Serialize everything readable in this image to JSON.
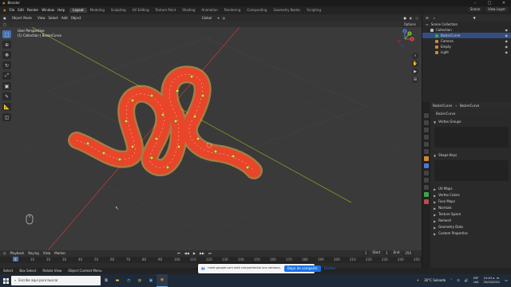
{
  "app": {
    "title": "Blender",
    "window_controls": [
      "–",
      "□",
      "✕"
    ]
  },
  "menubar": {
    "menus": [
      "File",
      "Edit",
      "Render",
      "Window",
      "Help"
    ],
    "workspaces": [
      "Layout",
      "Modeling",
      "Sculpting",
      "UV Editing",
      "Texture Paint",
      "Shading",
      "Animation",
      "Rendering",
      "Compositing",
      "Geometry Nodes",
      "Scripting"
    ],
    "active_workspace": "Layout",
    "scene": "Scene",
    "view_layer": "View Layer"
  },
  "viewport_header": {
    "mode": "Object Mode",
    "menus": [
      "View",
      "Select",
      "Add",
      "Object"
    ],
    "orientation": "Global",
    "options": "Options"
  },
  "viewport_info": {
    "line1": "User Perspective",
    "line2": "(1) Collection | BezierCurve"
  },
  "gizmo": {
    "x": "X",
    "y": "Y",
    "z": "Z"
  },
  "timeline": {
    "menus": [
      "Playback",
      "Keying",
      "View",
      "Marker"
    ],
    "current_frame": "1",
    "start_label": "Start",
    "start_value": "1",
    "end_label": "End",
    "end_value": "250",
    "ruler": [
      "0",
      "10",
      "20",
      "30",
      "40",
      "50",
      "60",
      "70",
      "80",
      "90",
      "100",
      "110",
      "120",
      "130",
      "140",
      "150",
      "160",
      "170",
      "180",
      "190",
      "200",
      "210",
      "220",
      "230",
      "240",
      "250"
    ]
  },
  "statusbar": {
    "items": [
      "Select",
      "Box Select",
      "Rotate View",
      "Object Context Menu"
    ]
  },
  "outliner": {
    "title": "Scene Collection",
    "rows": [
      {
        "label": "Collection",
        "indent": 1,
        "color": "#bbbbbb"
      },
      {
        "label": "BezierCurve",
        "indent": 2,
        "color": "#3fa34d",
        "selected": true
      },
      {
        "label": "Camera",
        "indent": 2,
        "color": "#c98a3a"
      },
      {
        "label": "Empty",
        "indent": 2,
        "color": "#c98a3a"
      },
      {
        "label": "Light",
        "indent": 2,
        "color": "#c98a3a"
      }
    ]
  },
  "properties": {
    "breadcrumb_obj": "BezierCurve",
    "breadcrumb_data": "BezierCurve",
    "data_name": "BezierCurve",
    "panels": [
      "Vertex Groups",
      "Shape Keys",
      "UV Maps",
      "Vertex Colors",
      "Face Maps",
      "Normals",
      "Texture Space",
      "Remesh",
      "Geometry Data",
      "Custom Properties"
    ]
  },
  "share_bar": {
    "message": "meet.google.com está compartiendo una ventana.",
    "share_button": "Dejar de compartir",
    "hide_button": "Ocultar"
  },
  "taskbar": {
    "search_placeholder": "Escribe aquí para buscar",
    "weather": "30°C  Soleado",
    "language": "ESP",
    "language2": "LAA",
    "time": "10:44 a. m.",
    "date": "20/10/2021"
  },
  "colors": {
    "accent": "#4772b3",
    "snake_body": "#e8452b",
    "snake_spots": "#e8d64a",
    "wire": "#ffb347"
  }
}
